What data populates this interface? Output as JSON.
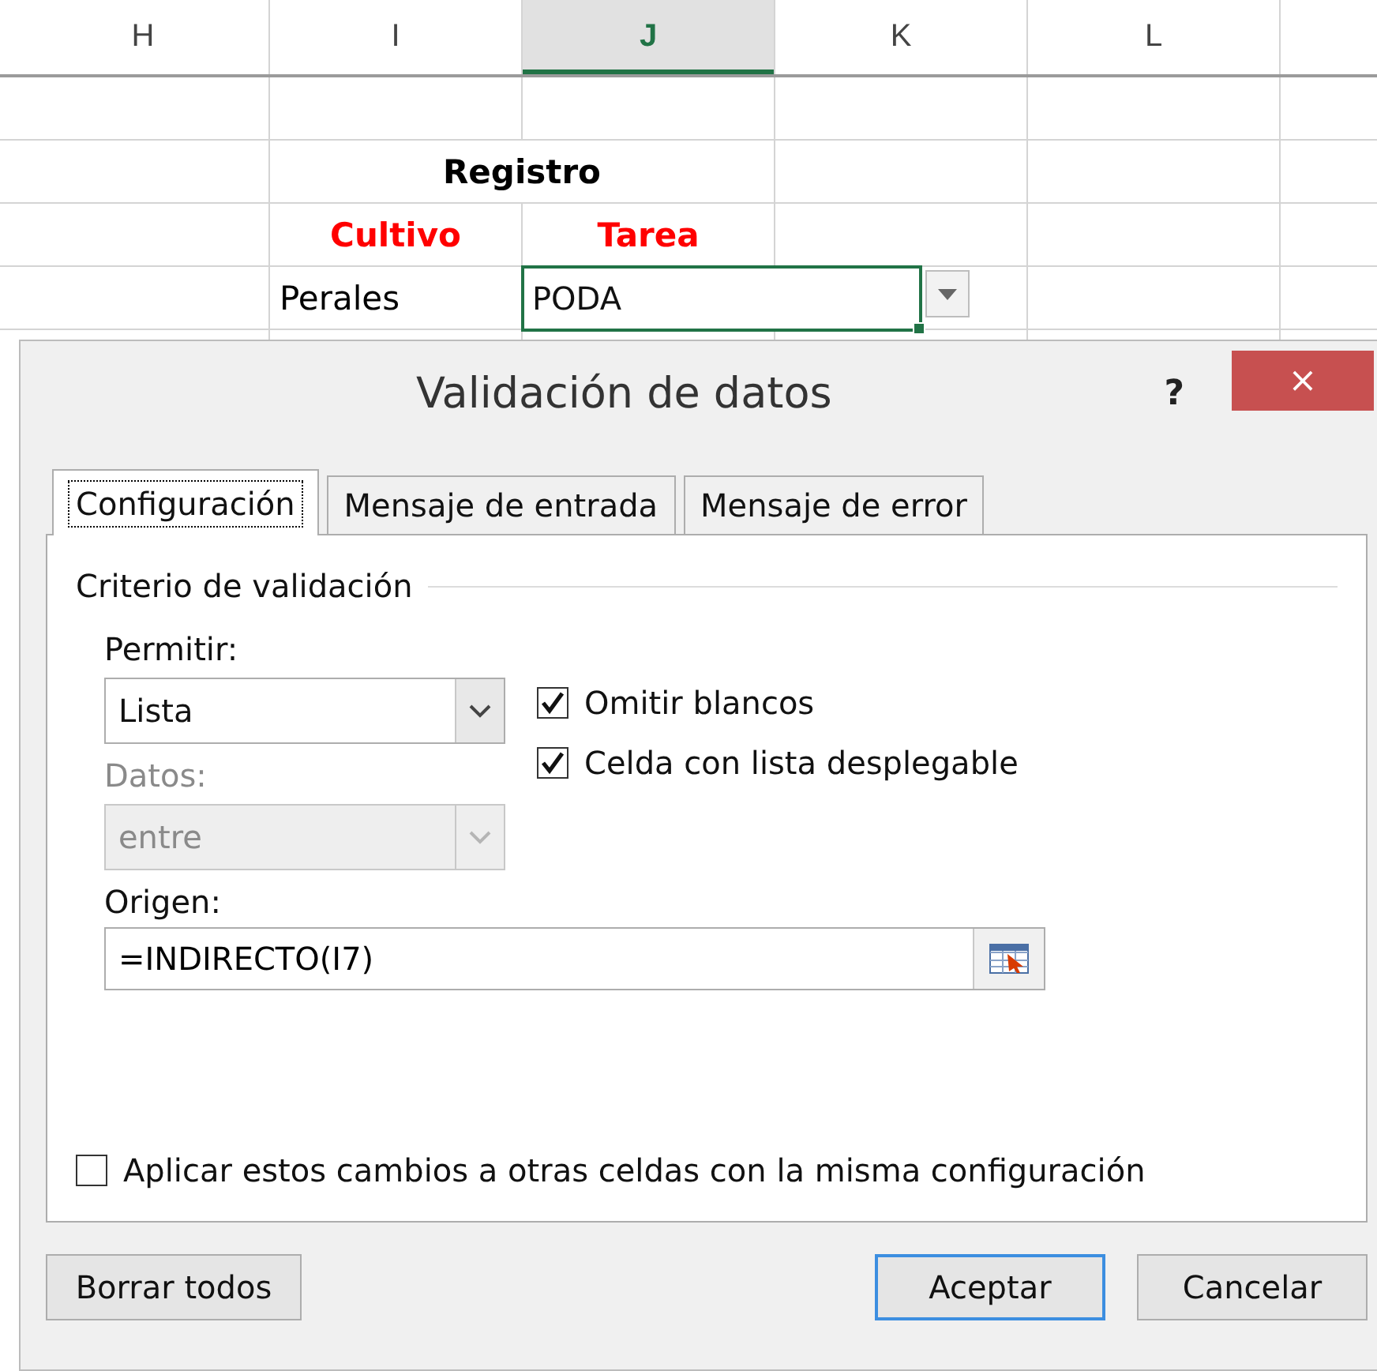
{
  "sheet": {
    "columns": [
      {
        "label": "H",
        "selected": false
      },
      {
        "label": "I",
        "selected": false
      },
      {
        "label": "J",
        "selected": true
      },
      {
        "label": "K",
        "selected": false
      },
      {
        "label": "L",
        "selected": false
      }
    ],
    "rows": [
      {
        "cells": [
          "",
          "",
          "",
          "",
          ""
        ]
      },
      {
        "cells": [
          "",
          {
            "kind": "title",
            "text": "Registro",
            "selected": false
          },
          "",
          ""
        ]
      },
      {
        "cells": [
          "",
          {
            "kind": "header",
            "text": "Cultivo",
            "selected": false
          },
          {
            "kind": "header",
            "text": "Tarea",
            "selected": false
          },
          "",
          ""
        ]
      },
      {
        "cells": [
          "",
          {
            "kind": "value",
            "text": "Perales",
            "selected": false
          },
          {
            "kind": "value",
            "text": "PODA",
            "selected": true
          },
          "",
          ""
        ]
      }
    ]
  },
  "dialog": {
    "title": "Validación de datos",
    "help": "?",
    "close": "×",
    "tabs": [
      {
        "label": "Configuración",
        "selected": true
      },
      {
        "label": "Mensaje de entrada",
        "selected": false
      },
      {
        "label": "Mensaje de error",
        "selected": false
      }
    ],
    "group_title": "Criterio de validación",
    "allow": {
      "label": "Permitir:",
      "value": "Lista",
      "disabled": false
    },
    "data": {
      "label": "Datos:",
      "value": "entre",
      "disabled": true
    },
    "options": [
      {
        "label": "Omitir blancos",
        "checked": true
      },
      {
        "label": "Celda con lista desplegable",
        "checked": true
      }
    ],
    "source": {
      "label": "Origen:",
      "value": "=INDIRECTO(I7)"
    },
    "apply_all": {
      "label": "Aplicar estos cambios a otras celdas con la misma configuración",
      "checked": false
    },
    "buttons": [
      {
        "label": "Borrar todos",
        "kind": "secondary"
      },
      {
        "label": "Aceptar",
        "kind": "default"
      },
      {
        "label": "Cancelar",
        "kind": "secondary"
      }
    ]
  }
}
